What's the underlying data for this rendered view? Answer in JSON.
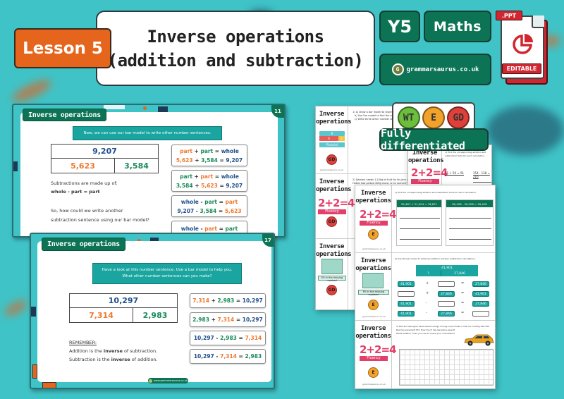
{
  "header": {
    "lesson_label": "Lesson 5",
    "title_line1": "Inverse operations",
    "title_line2": "(addition and subtraction)",
    "year": "Y5",
    "subject": "Maths",
    "brand": "grammarsaurus.co.uk",
    "brand_logo_letter": "G",
    "file_type": ".PPT",
    "editable_label": "EDITABLE",
    "file_icon": "pie-chart-icon"
  },
  "slide_11": {
    "tab_title": "Inverse operations",
    "slide_number": "11",
    "prompt": "Now, we can use our bar model to write other number sentences.",
    "bar_model": {
      "whole": "9,207",
      "part_a": "5,623",
      "part_b": "3,584"
    },
    "text_line1": "Subtractions are made up of:",
    "text_line2": "whole - part = part",
    "text_line3": "So, how could we write another",
    "text_line4": "subtraction sentence using our bar model?",
    "equations": [
      {
        "words": [
          "part",
          "+",
          "part",
          "=",
          "whole"
        ],
        "numbers": [
          "5,623",
          "+",
          "3,584",
          "=",
          "9,207"
        ]
      },
      {
        "words": [
          "part",
          "+",
          "part",
          "=",
          "whole"
        ],
        "numbers": [
          "3,584",
          "+",
          "5,623",
          "=",
          "9,207"
        ]
      },
      {
        "words": [
          "whole",
          "-",
          "part",
          "=",
          "part"
        ],
        "numbers": [
          "9,207",
          "-",
          "3,584",
          "=",
          "5,623"
        ]
      },
      {
        "words": [
          "whole",
          "-",
          "part",
          "=",
          "part"
        ]
      }
    ]
  },
  "slide_17": {
    "tab_title": "Inverse operations",
    "slide_number": "17",
    "prompt_line1": "Have a look at this number sentence. Use a bar model to help you.",
    "prompt_line2": "What other number sentences can you make?",
    "bar_model": {
      "whole": "10,297",
      "part_a": "7,314",
      "part_b": "2,983"
    },
    "remember_heading": "REMEMBER:",
    "remember_line1_pre": "Addition is the ",
    "remember_line1_bold": "inverse",
    "remember_line1_post": " of subtraction.",
    "remember_line2_pre": "Subtraction is the ",
    "remember_line2_bold": "inverse",
    "remember_line2_post": " of addition.",
    "equations": [
      [
        "7,314",
        "+",
        "2,983",
        "=",
        "10,297"
      ],
      [
        "2,983",
        "+",
        "7,314",
        "=",
        "10,297"
      ],
      [
        "10,297",
        "-",
        "2,983",
        "=",
        "7,314"
      ],
      [
        "10,297",
        "-",
        "7,314",
        "=",
        "2,983"
      ]
    ],
    "footer_brand": "www.grammarsaurus.co.uk"
  },
  "differentiation": {
    "levels": [
      "WT",
      "E",
      "GD"
    ],
    "banner": "Fully differentiated"
  },
  "worksheets": {
    "title_line1": "Inverse",
    "title_line2": "operations",
    "fluency_eq": "2+2=4",
    "fluency_label": "Fluency",
    "pictorial_label": "Pictorial",
    "missing_number_label": "Fill in the missing number!",
    "bar_whole": "8",
    "bar_a": "6",
    "bar_b": "2",
    "q1_text": "1) Find the corresponding addition and subtraction facts for each calculation.",
    "eq_card_a": "55,467 + 21,204 = 76,671",
    "eq_card_b": "89,456 - 30,028 = 59,428",
    "eq_fill_a": "35 + 56 = 91",
    "eq_fill_b": "354 - 138 = 216",
    "q2_text": "2) Use the bar model to write two addition and two subtraction calculations.",
    "bar2_whole": "41,901",
    "bar2_unknown": "?",
    "bar2_part": "27,846",
    "chips": [
      "41,901",
      "27,846"
    ],
    "q3_text_line1": "3) Rex and Georgina have saved enough money to purchase a new car costing £16,353.",
    "q3_text_line2": "Rex has saved £8,733. How much has Georgina saved?",
    "q3_text_line3": "What addition could you use to check your calculation?",
    "check_text": "Use a number line to check your answer.",
    "brand_small": "grammarsaurus.co.uk",
    "gd_q1_line1": "1) a) Draw a bar model to represent...",
    "gd_q1_line2": "b) Use the model to find the answer",
    "gd_q1_line3": "c) Write three other number sentences",
    "gd_q2_line1": "2) Damien needs 1,240g of fruit for his jam recipe.",
    "gd_q2_line2": "Hattie had picked 400g more; is he correct? Why?"
  },
  "colors": {
    "background": "#3fc3c7",
    "brand_green": "#0c7354",
    "lesson_orange": "#e5651c",
    "ppt_red": "#d12630",
    "whole_blue": "#1f4e8c",
    "part_orange": "#ee7a2e",
    "part_green": "#1a8a5a",
    "prompt_teal": "#1aa5a0"
  }
}
